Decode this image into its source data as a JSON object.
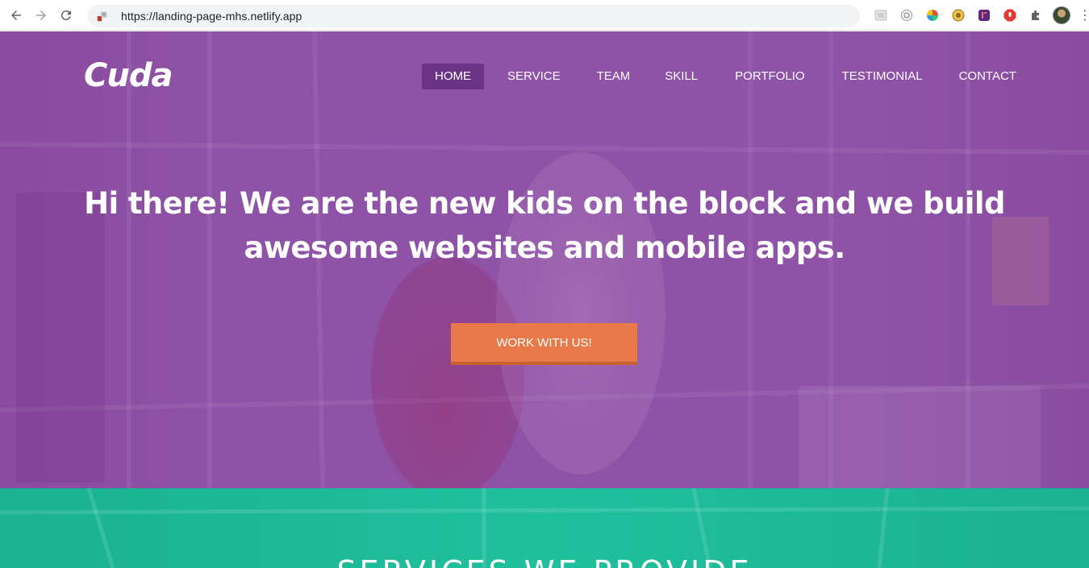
{
  "browser": {
    "url": "https://landing-page-mhs.netlify.app",
    "extensions": [
      "extension-icon",
      "extension-icon",
      "color-wheel-icon",
      "extension-icon",
      "extension-icon",
      "adblock-icon",
      "puzzle-icon"
    ]
  },
  "site": {
    "logo": "Cuda",
    "nav": {
      "items": [
        {
          "label": "HOME",
          "active": true
        },
        {
          "label": "SERVICE"
        },
        {
          "label": "TEAM"
        },
        {
          "label": "SKILL"
        },
        {
          "label": "PORTFOLIO"
        },
        {
          "label": "TESTIMONIAL"
        },
        {
          "label": "CONTACT"
        }
      ]
    },
    "hero": {
      "title_line1": "Hi there! We are the new kids on the block and we build",
      "title_line2": "awesome websites and mobile apps.",
      "cta": "WORK WITH US!"
    },
    "services": {
      "title": "SERVICES WE PROVIDE"
    }
  },
  "colors": {
    "hero_purple": "#8e5aa3",
    "nav_active": "#6a3386",
    "cta_orange": "#e8794a",
    "services_teal": "#1fbf9c"
  }
}
